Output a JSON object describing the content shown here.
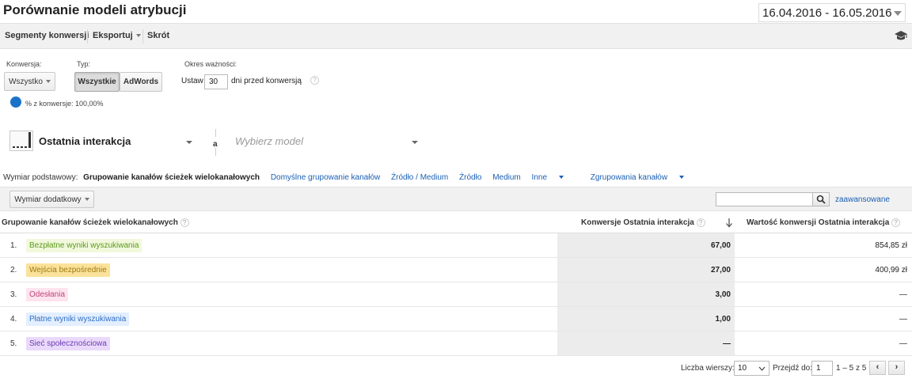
{
  "header": {
    "title": "Porównanie modeli atrybucji",
    "date_range": "16.04.2016 - 16.05.2016"
  },
  "toolbar": {
    "segments": "Segmenty konwersji",
    "export": "Eksportuj",
    "shortcut": "Skrót",
    "icon": "graduation-cap-icon"
  },
  "controls": {
    "conversion_label": "Konwersja:",
    "conversion_value": "Wszystko",
    "type_label": "Typ:",
    "type_options": [
      "Wszystkie",
      "AdWords"
    ],
    "type_selected": "Wszystkie",
    "lookback_label": "Okres ważności:",
    "lookback_prefix": "Ustaw",
    "lookback_days": "30",
    "lookback_suffix": "dni przed konwersją",
    "percent_text": "% z konwersje: 100,00%"
  },
  "model": {
    "primary": "Ostatnia interakcja",
    "vs_letter": "a",
    "secondary_placeholder": "Wybierz model"
  },
  "dimension": {
    "label": "Wymiar podstawowy:",
    "active": "Grupowanie kanałów ścieżek wielokanałowych",
    "links": [
      "Domyślne grupowanie kanałów",
      "Źródło / Medium",
      "Źródło",
      "Medium",
      "Inne"
    ],
    "channel_groupings": "Zgrupowania kanałów"
  },
  "filter": {
    "secondary_dimension": "Wymiar dodatkowy",
    "search_value": "",
    "advanced": "zaawansowane"
  },
  "table": {
    "headers": {
      "dimension": "Grupowanie kanałów ścieżek wielokanałowych",
      "conversions": "Konwersje Ostatnia interakcja",
      "value": "Wartość konwersji Ostatnia interakcja"
    },
    "rows": [
      {
        "idx": "1.",
        "channel": "Bezpłatne wyniki wyszukiwania",
        "conversions": "67,00",
        "value": "854,85 zł",
        "bg": "#f1f8dc",
        "fg": "#5b9a1d"
      },
      {
        "idx": "2.",
        "channel": "Wejścia bezpośrednie",
        "conversions": "27,00",
        "value": "400,99 zł",
        "bg": "#fbe29b",
        "fg": "#a07a10"
      },
      {
        "idx": "3.",
        "channel": "Odesłania",
        "conversions": "3,00",
        "value": "—",
        "bg": "#fde4ee",
        "fg": "#c2447c"
      },
      {
        "idx": "4.",
        "channel": "Płatne wyniki wyszukiwania",
        "conversions": "1,00",
        "value": "—",
        "bg": "#e3efff",
        "fg": "#2f6fc4"
      },
      {
        "idx": "5.",
        "channel": "Sieć społecznościowa",
        "conversions": "—",
        "value": "—",
        "bg": "#ead9fb",
        "fg": "#6c3fb0"
      }
    ]
  },
  "pagination": {
    "rows_label": "Liczba wierszy:",
    "rows_value": "10",
    "goto_label": "Przejdź do:",
    "goto_value": "1",
    "range": "1 – 5 z 5",
    "prev": "‹",
    "next": "›"
  }
}
